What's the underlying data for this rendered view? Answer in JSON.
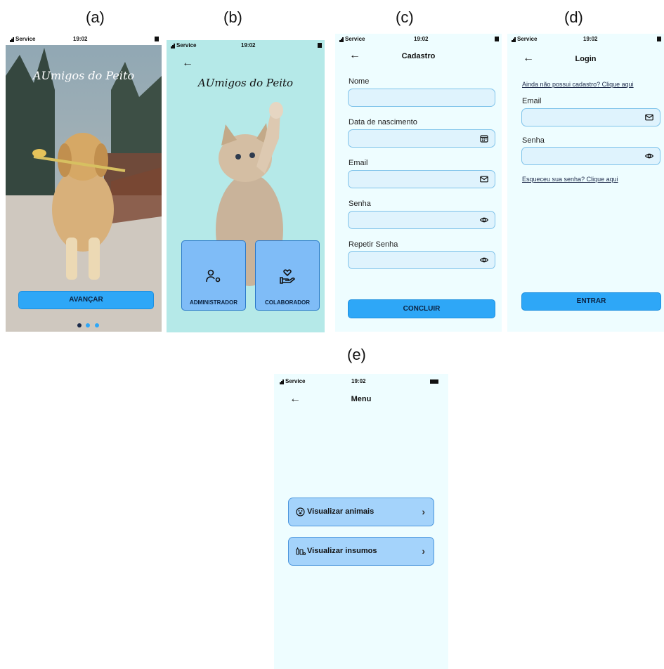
{
  "captions": [
    "(a)",
    "(b)",
    "(c)",
    "(d)",
    "(e)"
  ],
  "status": {
    "carrier": "Service",
    "time": "19:02"
  },
  "app_name": "AUmigos do Peito",
  "screen_a": {
    "button": "AVANÇAR",
    "dots": 3
  },
  "screen_b": {
    "back": "←",
    "admin_label": "ADMINISTRADOR",
    "collab_label": "COLABORADOR"
  },
  "screen_c": {
    "back": "←",
    "title": "Cadastro",
    "fields": [
      {
        "label": "Nome",
        "icon": "none"
      },
      {
        "label": "Data de nascimento",
        "icon": "calendar-icon"
      },
      {
        "label": "Email",
        "icon": "mail-icon"
      },
      {
        "label": "Senha",
        "icon": "eye-icon"
      },
      {
        "label": "Repetir Senha",
        "icon": "eye-icon"
      }
    ],
    "button": "CONCLUIR"
  },
  "screen_d": {
    "back": "←",
    "title": "Login",
    "register_link": "Ainda não possui cadastro? Clique aqui",
    "email_label": "Email",
    "password_label": "Senha",
    "forgot_link": "Esqueceu sua senha? Clique aqui",
    "button": "ENTRAR"
  },
  "screen_e": {
    "back": "←",
    "title": "Menu",
    "items": [
      {
        "label": "Visualizar animais",
        "icon": "paw-icon"
      },
      {
        "label": "Visualizar insumos",
        "icon": "supplies-icon"
      }
    ],
    "chevron": "›"
  },
  "colors": {
    "background": "#eefdff",
    "primary_button": "#2ea7f7",
    "field_fill": "#dff3fd",
    "field_border": "#7fc3ea"
  }
}
